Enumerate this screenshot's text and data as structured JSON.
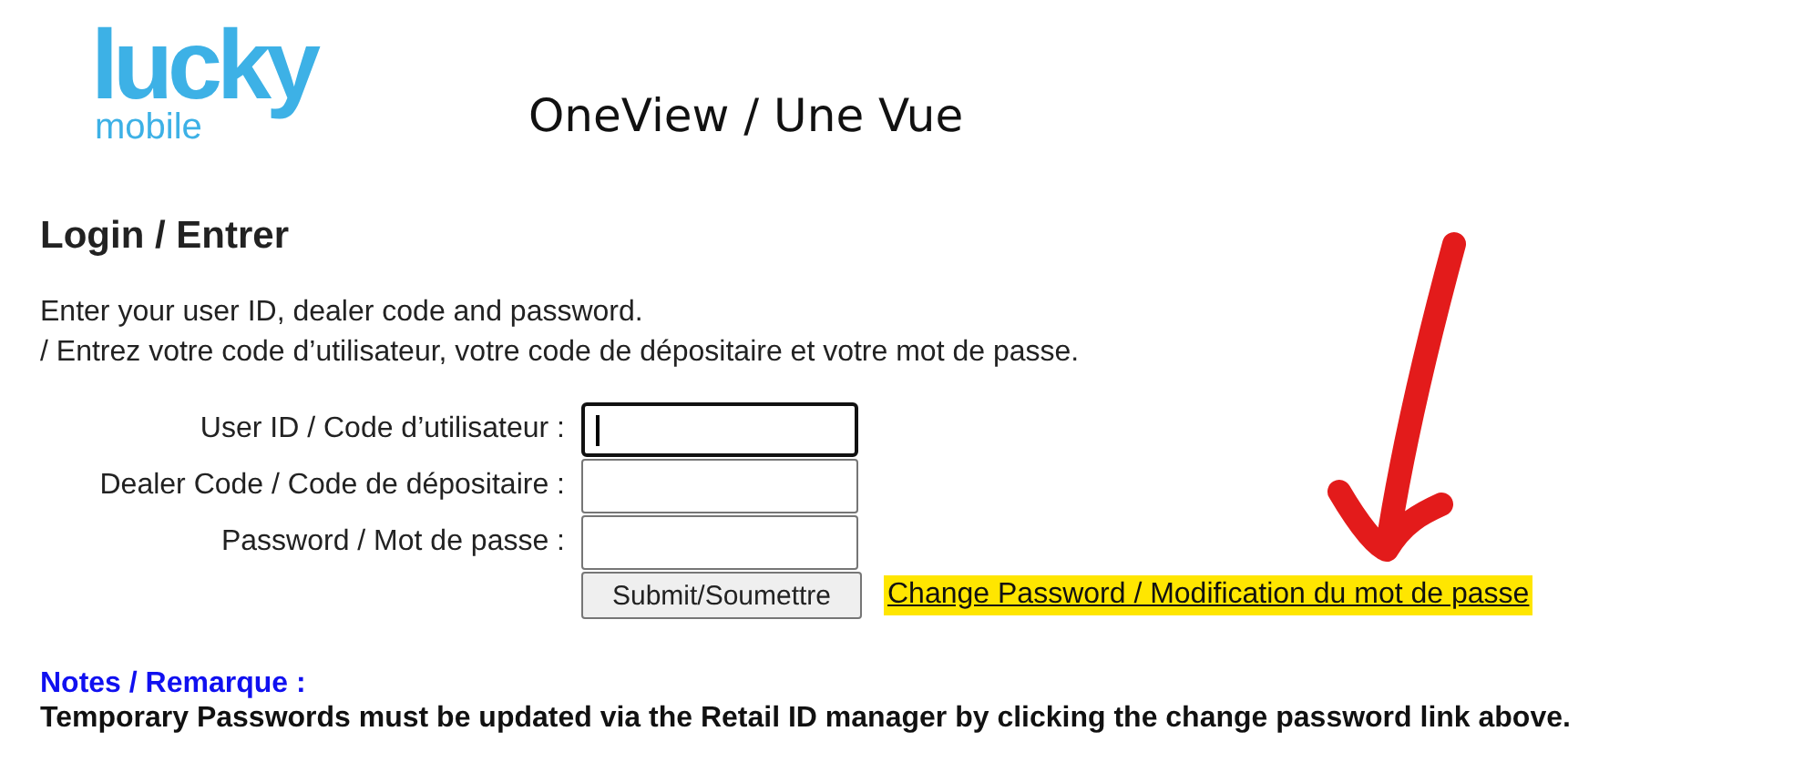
{
  "logo": {
    "wordmark": "lucky",
    "subtitle": "mobile"
  },
  "header": {
    "title": "OneView / Une Vue"
  },
  "login": {
    "heading": "Login / Entrer",
    "instructions": [
      "Enter your user ID, dealer code and password.",
      "/ Entrez votre code d’utilisateur, votre code de dépositaire et votre mot de passe."
    ],
    "fields": [
      {
        "label": "User ID / Code d’utilisateur :",
        "focused": true
      },
      {
        "label": "Dealer Code / Code de dépositaire :",
        "focused": false
      },
      {
        "label": "Password / Mot de passe :",
        "focused": false
      }
    ],
    "submit_button": "Submit/Soumettre",
    "change_password_link": {
      "label": "Change Password / Modification du mot de passe",
      "highlighted": true
    }
  },
  "notes": {
    "heading": "Notes / Remarque :",
    "text": "Temporary Passwords must be updated via the Retail ID manager by clicking the change password link above."
  }
}
